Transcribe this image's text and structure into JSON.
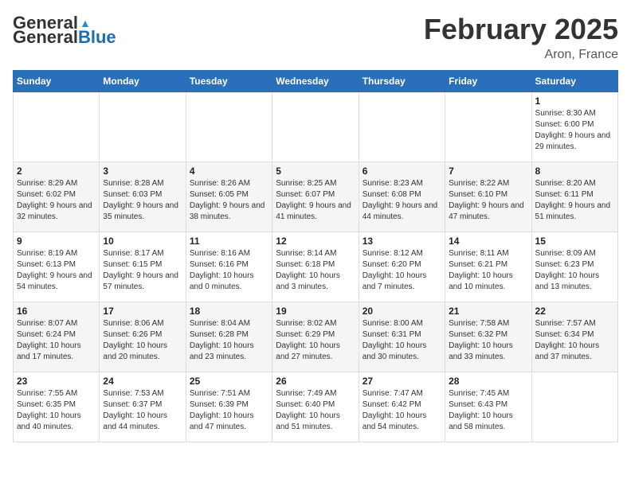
{
  "header": {
    "logo": {
      "general": "General",
      "blue": "Blue",
      "tagline": ""
    },
    "title": "February 2025",
    "location": "Aron, France"
  },
  "calendar": {
    "days_of_week": [
      "Sunday",
      "Monday",
      "Tuesday",
      "Wednesday",
      "Thursday",
      "Friday",
      "Saturday"
    ],
    "weeks": [
      [
        {
          "day": "",
          "info": ""
        },
        {
          "day": "",
          "info": ""
        },
        {
          "day": "",
          "info": ""
        },
        {
          "day": "",
          "info": ""
        },
        {
          "day": "",
          "info": ""
        },
        {
          "day": "",
          "info": ""
        },
        {
          "day": "1",
          "info": "Sunrise: 8:30 AM\nSunset: 6:00 PM\nDaylight: 9 hours and 29 minutes."
        }
      ],
      [
        {
          "day": "2",
          "info": "Sunrise: 8:29 AM\nSunset: 6:02 PM\nDaylight: 9 hours and 32 minutes."
        },
        {
          "day": "3",
          "info": "Sunrise: 8:28 AM\nSunset: 6:03 PM\nDaylight: 9 hours and 35 minutes."
        },
        {
          "day": "4",
          "info": "Sunrise: 8:26 AM\nSunset: 6:05 PM\nDaylight: 9 hours and 38 minutes."
        },
        {
          "day": "5",
          "info": "Sunrise: 8:25 AM\nSunset: 6:07 PM\nDaylight: 9 hours and 41 minutes."
        },
        {
          "day": "6",
          "info": "Sunrise: 8:23 AM\nSunset: 6:08 PM\nDaylight: 9 hours and 44 minutes."
        },
        {
          "day": "7",
          "info": "Sunrise: 8:22 AM\nSunset: 6:10 PM\nDaylight: 9 hours and 47 minutes."
        },
        {
          "day": "8",
          "info": "Sunrise: 8:20 AM\nSunset: 6:11 PM\nDaylight: 9 hours and 51 minutes."
        }
      ],
      [
        {
          "day": "9",
          "info": "Sunrise: 8:19 AM\nSunset: 6:13 PM\nDaylight: 9 hours and 54 minutes."
        },
        {
          "day": "10",
          "info": "Sunrise: 8:17 AM\nSunset: 6:15 PM\nDaylight: 9 hours and 57 minutes."
        },
        {
          "day": "11",
          "info": "Sunrise: 8:16 AM\nSunset: 6:16 PM\nDaylight: 10 hours and 0 minutes."
        },
        {
          "day": "12",
          "info": "Sunrise: 8:14 AM\nSunset: 6:18 PM\nDaylight: 10 hours and 3 minutes."
        },
        {
          "day": "13",
          "info": "Sunrise: 8:12 AM\nSunset: 6:20 PM\nDaylight: 10 hours and 7 minutes."
        },
        {
          "day": "14",
          "info": "Sunrise: 8:11 AM\nSunset: 6:21 PM\nDaylight: 10 hours and 10 minutes."
        },
        {
          "day": "15",
          "info": "Sunrise: 8:09 AM\nSunset: 6:23 PM\nDaylight: 10 hours and 13 minutes."
        }
      ],
      [
        {
          "day": "16",
          "info": "Sunrise: 8:07 AM\nSunset: 6:24 PM\nDaylight: 10 hours and 17 minutes."
        },
        {
          "day": "17",
          "info": "Sunrise: 8:06 AM\nSunset: 6:26 PM\nDaylight: 10 hours and 20 minutes."
        },
        {
          "day": "18",
          "info": "Sunrise: 8:04 AM\nSunset: 6:28 PM\nDaylight: 10 hours and 23 minutes."
        },
        {
          "day": "19",
          "info": "Sunrise: 8:02 AM\nSunset: 6:29 PM\nDaylight: 10 hours and 27 minutes."
        },
        {
          "day": "20",
          "info": "Sunrise: 8:00 AM\nSunset: 6:31 PM\nDaylight: 10 hours and 30 minutes."
        },
        {
          "day": "21",
          "info": "Sunrise: 7:58 AM\nSunset: 6:32 PM\nDaylight: 10 hours and 33 minutes."
        },
        {
          "day": "22",
          "info": "Sunrise: 7:57 AM\nSunset: 6:34 PM\nDaylight: 10 hours and 37 minutes."
        }
      ],
      [
        {
          "day": "23",
          "info": "Sunrise: 7:55 AM\nSunset: 6:35 PM\nDaylight: 10 hours and 40 minutes."
        },
        {
          "day": "24",
          "info": "Sunrise: 7:53 AM\nSunset: 6:37 PM\nDaylight: 10 hours and 44 minutes."
        },
        {
          "day": "25",
          "info": "Sunrise: 7:51 AM\nSunset: 6:39 PM\nDaylight: 10 hours and 47 minutes."
        },
        {
          "day": "26",
          "info": "Sunrise: 7:49 AM\nSunset: 6:40 PM\nDaylight: 10 hours and 51 minutes."
        },
        {
          "day": "27",
          "info": "Sunrise: 7:47 AM\nSunset: 6:42 PM\nDaylight: 10 hours and 54 minutes."
        },
        {
          "day": "28",
          "info": "Sunrise: 7:45 AM\nSunset: 6:43 PM\nDaylight: 10 hours and 58 minutes."
        },
        {
          "day": "",
          "info": ""
        }
      ]
    ]
  }
}
